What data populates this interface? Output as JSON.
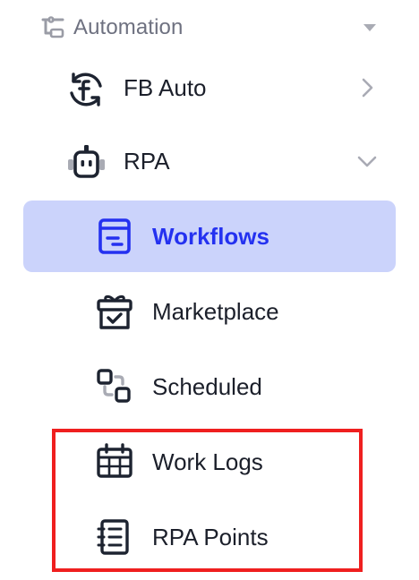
{
  "colors": {
    "section_label": "#6e7180",
    "text": "#1b1f2a",
    "icon": "#1d2330",
    "active_background": "#cbd3fb",
    "active_text": "#2431f0",
    "highlight_border": "#ef1f1f"
  },
  "section": {
    "label": "Automation",
    "icon": "automation-icon",
    "state": "expanded"
  },
  "items": [
    {
      "label": "FB Auto",
      "icon": "facebook-sync-icon",
      "chevron": "right"
    },
    {
      "label": "RPA",
      "icon": "robot-icon",
      "chevron": "down"
    }
  ],
  "rpa_children": [
    {
      "label": "Workflows",
      "icon": "workflow-card-icon",
      "active": true
    },
    {
      "label": "Marketplace",
      "icon": "gift-box-icon",
      "active": false
    },
    {
      "label": "Scheduled",
      "icon": "schedule-nodes-icon",
      "active": false
    },
    {
      "label": "Work Logs",
      "icon": "calendar-grid-icon",
      "active": false
    },
    {
      "label": "RPA Points",
      "icon": "points-notebook-icon",
      "active": false
    }
  ],
  "annotation": {
    "type": "highlight-rectangle",
    "color": "#ef1f1f",
    "encloses": [
      "Work Logs",
      "RPA Points"
    ]
  }
}
